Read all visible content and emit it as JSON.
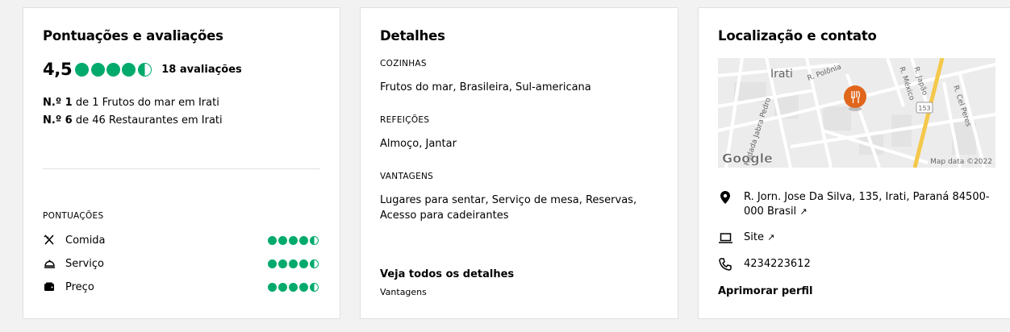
{
  "ratings_card": {
    "title": "Pontuações e avaliações",
    "overall_rating": "4,5",
    "overall_bubbles": 4.5,
    "review_count": "18 avaliações",
    "ranks": [
      {
        "position": "N.º 1",
        "text": " de 1 Frutos do mar em Irati"
      },
      {
        "position": "N.º 6",
        "text": " de 46 Restaurantes em Irati"
      }
    ],
    "section_label": "PONTUAÇÕES",
    "subratings": [
      {
        "label": "Comida",
        "icon": "fork-knife-icon",
        "bubbles": 4.5
      },
      {
        "label": "Serviço",
        "icon": "cloche-icon",
        "bubbles": 4.5
      },
      {
        "label": "Preço",
        "icon": "wallet-icon",
        "bubbles": 4.5
      }
    ],
    "accent_color": "#00aa6c"
  },
  "details_card": {
    "title": "Detalhes",
    "cuisines_label": "COZINHAS",
    "cuisines_value": "Frutos do mar, Brasileira, Sul-americana",
    "meals_label": "REFEIÇÕES",
    "meals_value": "Almoço, Jantar",
    "features_label": "VANTAGENS",
    "features_value": "Lugares para sentar, Serviço de mesa, Reservas, Acesso para cadeirantes",
    "see_all_label": "Veja todos os detalhes",
    "see_all_sub": "Vantagens"
  },
  "location_card": {
    "title": "Localização e contato",
    "map": {
      "city_label": "Irati",
      "street_labels": [
        "R. Polônia",
        "R. Japão",
        "R. México",
        "R. Cel Peres",
        "Rodada Jabra Pedro"
      ],
      "route_shield": "153",
      "google_logo": "Google",
      "map_data": "Map data ©2022",
      "pin_icon": "restaurant-pin-icon",
      "pin_color": "#e0661b"
    },
    "address": "R. Jorn. Jose Da Silva, 135, Irati, Paraná 84500-000 Brasil",
    "site_label": "Site",
    "phone": "4234223612",
    "improve_label": "Aprimorar perfil"
  }
}
